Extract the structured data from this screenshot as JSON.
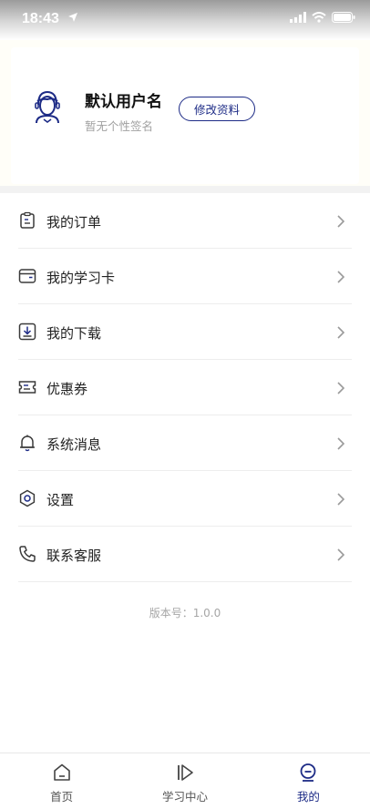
{
  "status_bar": {
    "time": "18:43"
  },
  "profile": {
    "name": "默认用户名",
    "signature": "暂无个性签名",
    "edit_label": "修改资料"
  },
  "menu": [
    {
      "label": "我的订单",
      "icon": "order-icon"
    },
    {
      "label": "我的学习卡",
      "icon": "card-icon"
    },
    {
      "label": "我的下载",
      "icon": "download-icon"
    },
    {
      "label": "优惠券",
      "icon": "coupon-icon"
    },
    {
      "label": "系统消息",
      "icon": "bell-icon"
    },
    {
      "label": "设置",
      "icon": "settings-icon"
    },
    {
      "label": "联系客服",
      "icon": "phone-icon"
    }
  ],
  "version_text": "版本号：1.0.0",
  "tabbar": [
    {
      "label": "首页",
      "icon": "home-icon",
      "active": false
    },
    {
      "label": "学习中心",
      "icon": "study-center-icon",
      "active": false
    },
    {
      "label": "我的",
      "icon": "profile-icon",
      "active": true
    }
  ],
  "colors": {
    "accent": "#1d2b86",
    "icon": "#3a3a3a",
    "muted": "#a0a0a0"
  }
}
